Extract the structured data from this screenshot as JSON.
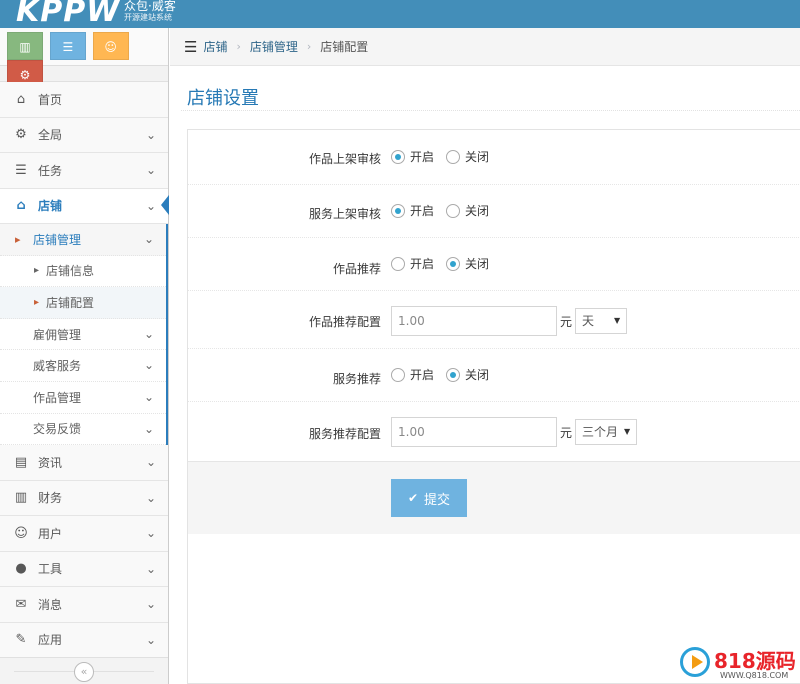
{
  "header": {
    "logo": "KPPW",
    "subtitle": "众包·威客",
    "subtitle_small": "开源建站系统"
  },
  "sidebar": {
    "shortcuts": [
      {
        "icon": "bar-chart-icon",
        "color": "#87b87f"
      },
      {
        "icon": "list-icon",
        "color": "#6fb3e0"
      },
      {
        "icon": "users-icon",
        "color": "#ffb752"
      },
      {
        "icon": "cogs-icon",
        "color": "#d15b47"
      }
    ],
    "items": [
      {
        "label": "首页",
        "icon": "home-icon"
      },
      {
        "label": "全局",
        "icon": "gear-icon"
      },
      {
        "label": "任务",
        "icon": "tasks-icon"
      },
      {
        "label": "店铺",
        "icon": "home-icon",
        "active": true
      },
      {
        "label": "资讯",
        "icon": "file-icon"
      },
      {
        "label": "财务",
        "icon": "bar-chart-icon"
      },
      {
        "label": "用户",
        "icon": "users-icon"
      },
      {
        "label": "工具",
        "icon": "user-icon"
      },
      {
        "label": "消息",
        "icon": "envelope-icon"
      },
      {
        "label": "应用",
        "icon": "edit-icon"
      }
    ],
    "shop_submenu": [
      {
        "label": "店铺管理",
        "open": true,
        "children": [
          "店铺信息",
          "店铺配置"
        ]
      },
      {
        "label": "雇佣管理"
      },
      {
        "label": "威客服务"
      },
      {
        "label": "作品管理"
      },
      {
        "label": "交易反馈"
      }
    ],
    "collapse_glyph": "«"
  },
  "breadcrumb": {
    "items": [
      "店铺",
      "店铺管理"
    ],
    "current": "店铺配置"
  },
  "page": {
    "title": "店铺设置"
  },
  "form": {
    "work_review": {
      "label": "作品上架审核",
      "options": [
        "开启",
        "关闭"
      ],
      "selected": "开启"
    },
    "service_review": {
      "label": "服务上架审核",
      "options": [
        "开启",
        "关闭"
      ],
      "selected": "开启"
    },
    "work_recommend": {
      "label": "作品推荐",
      "options": [
        "开启",
        "关闭"
      ],
      "selected": "关闭"
    },
    "work_recommend_config": {
      "label": "作品推荐配置",
      "value": "1.00",
      "unit": "元",
      "period": "天"
    },
    "service_recommend": {
      "label": "服务推荐",
      "options": [
        "开启",
        "关闭"
      ],
      "selected": "关闭"
    },
    "service_recommend_config": {
      "label": "服务推荐配置",
      "value": "1.00",
      "unit": "元",
      "period": "三个月"
    },
    "submit_label": "提交"
  },
  "watermark": {
    "text": "818源码",
    "url": "WWW.Q818.COM"
  }
}
